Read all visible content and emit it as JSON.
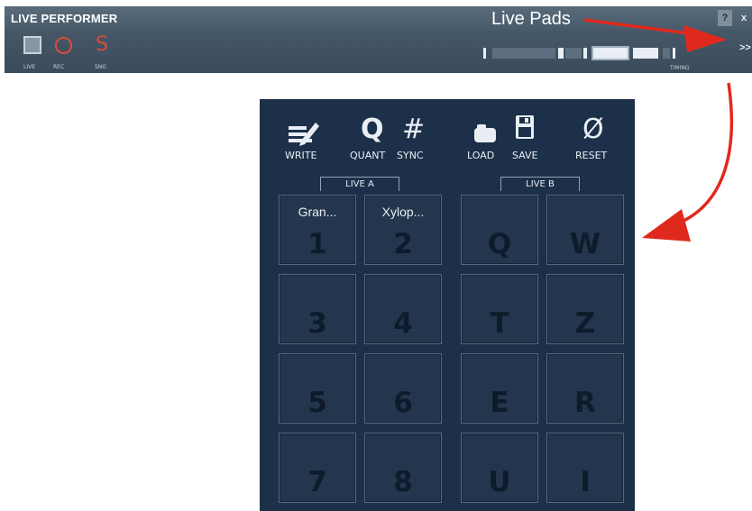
{
  "app": {
    "title": "LIVE PERFORMER",
    "help_label": "?",
    "close_label": "x",
    "expand_label": ">>"
  },
  "annotation": {
    "text": "Live Pads",
    "arrow_color": "#e0291d"
  },
  "toolbar": {
    "live_label": "LIVE",
    "rec_label": "REC",
    "sng_label": "SNG",
    "sng_glyph": "S",
    "timing_label": "TIMING"
  },
  "panel": {
    "tools": [
      {
        "id": "write",
        "label": "WRITE",
        "icon": "pencil-write-icon"
      },
      {
        "id": "quant",
        "label": "QUANT",
        "icon": "q-icon",
        "glyph": "Q"
      },
      {
        "id": "sync",
        "label": "SYNC",
        "icon": "hash-icon",
        "glyph": "#"
      },
      {
        "id": "load",
        "label": "LOAD",
        "icon": "folder-icon"
      },
      {
        "id": "save",
        "label": "SAVE",
        "icon": "floppy-icon"
      },
      {
        "id": "reset",
        "label": "RESET",
        "icon": "empty-set-icon",
        "glyph": "Ø"
      }
    ],
    "group_a": "LIVE A",
    "group_b": "LIVE B",
    "pads_a": [
      {
        "name": "Gran...",
        "key": "1"
      },
      {
        "name": "Xylop...",
        "key": "2"
      },
      {
        "name": "",
        "key": "3"
      },
      {
        "name": "",
        "key": "4"
      },
      {
        "name": "",
        "key": "5"
      },
      {
        "name": "",
        "key": "6"
      },
      {
        "name": "",
        "key": "7"
      },
      {
        "name": "",
        "key": "8"
      }
    ],
    "pads_b": [
      {
        "name": "",
        "key": "Q"
      },
      {
        "name": "",
        "key": "W"
      },
      {
        "name": "",
        "key": "T"
      },
      {
        "name": "",
        "key": "Z"
      },
      {
        "name": "",
        "key": "E"
      },
      {
        "name": "",
        "key": "R"
      },
      {
        "name": "",
        "key": "U"
      },
      {
        "name": "",
        "key": "I"
      }
    ]
  },
  "colors": {
    "toolbar_bg": "#3e4f5f",
    "panel_bg": "#1d3049",
    "accent_red": "#e0483c"
  }
}
